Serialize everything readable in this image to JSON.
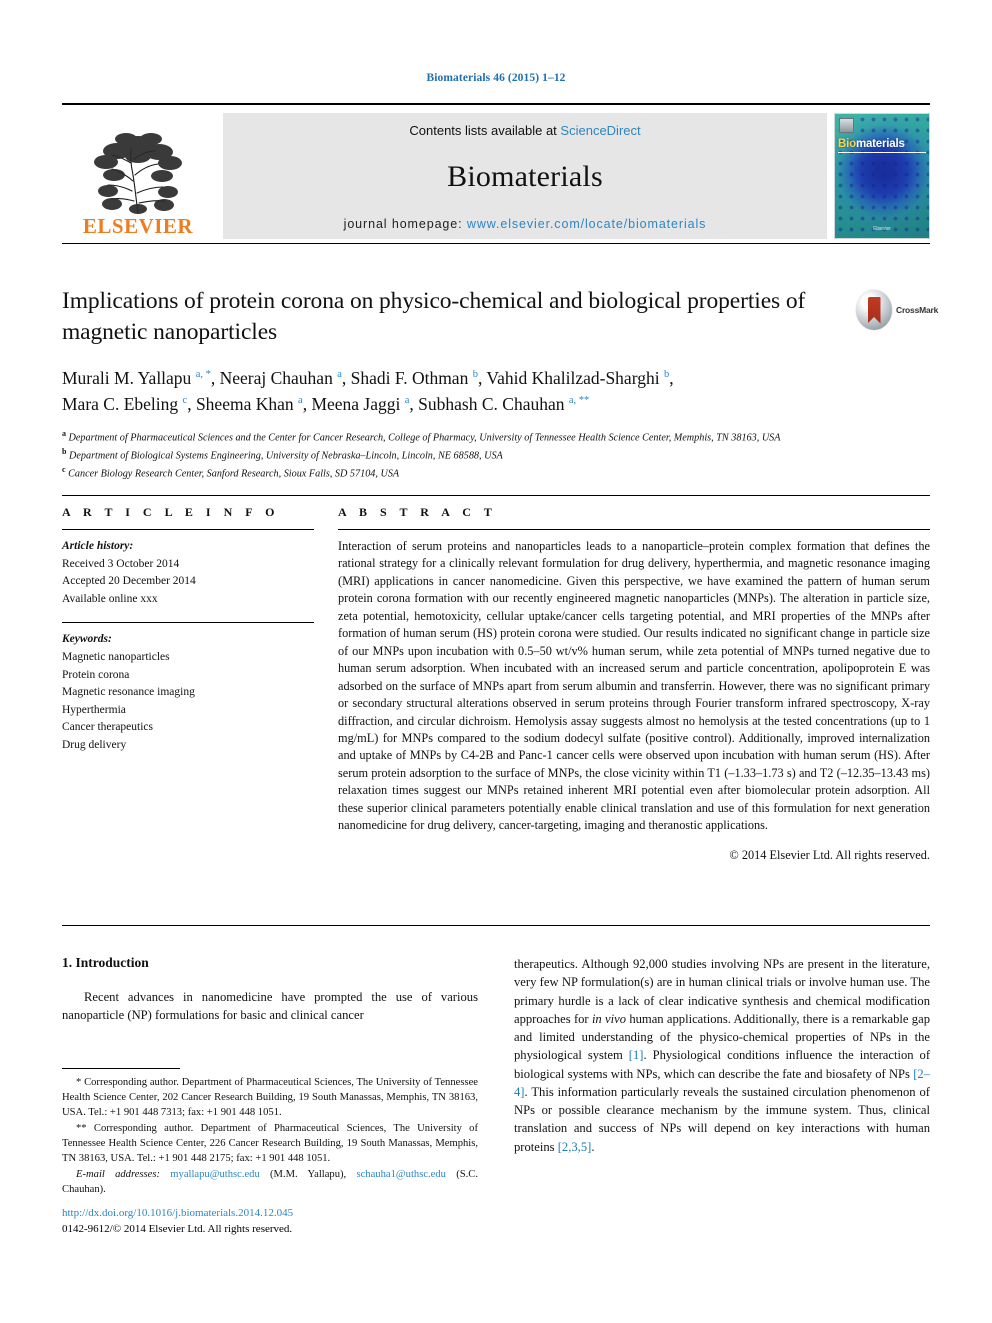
{
  "running_head": "Biomaterials 46 (2015) 1–12",
  "masthead": {
    "publisher_name": "ELSEVIER",
    "contents_prefix": "Contents lists available at",
    "contents_link": "ScienceDirect",
    "journal_name": "Biomaterials",
    "homepage_prefix": "journal homepage:",
    "homepage_url": "www.elsevier.com/locate/biomaterials",
    "cover_title_accent": "Bio",
    "cover_title_rest": "materials",
    "cover_footer": "Elsevier"
  },
  "article": {
    "title": "Implications of protein corona on physico-chemical and biological properties of magnetic nanoparticles",
    "crossmark_label": "CrossMark",
    "authors_line_1": "Murali M. Yallapu",
    "authors_html": "Murali M. Yallapu <sup>a, *</sup>, Neeraj Chauhan <sup>a</sup>, Shadi F. Othman <sup>b</sup>, Vahid Khalilzad-Sharghi <sup>b</sup>, Mara C. Ebeling <sup>c</sup>, Sheema Khan <sup>a</sup>, Meena Jaggi <sup>a</sup>, Subhash C. Chauhan <sup>a, **</sup>",
    "affiliation_a": "Department of Pharmaceutical Sciences and the Center for Cancer Research, College of Pharmacy, University of Tennessee Health Science Center, Memphis, TN 38163, USA",
    "affiliation_b": "Department of Biological Systems Engineering, University of Nebraska–Lincoln, Lincoln, NE 68588, USA",
    "affiliation_c": "Cancer Biology Research Center, Sanford Research, Sioux Falls, SD 57104, USA"
  },
  "article_info": {
    "heading": "A R T I C L E  I N F O",
    "history_label": "Article history:",
    "received": "Received 3 October 2014",
    "accepted": "Accepted 20 December 2014",
    "available": "Available online xxx",
    "keywords_label": "Keywords:",
    "keywords": [
      "Magnetic nanoparticles",
      "Protein corona",
      "Magnetic resonance imaging",
      "Hyperthermia",
      "Cancer therapeutics",
      "Drug delivery"
    ]
  },
  "abstract": {
    "heading": "A B S T R A C T",
    "text": "Interaction of serum proteins and nanoparticles leads to a nanoparticle–protein complex formation that defines the rational strategy for a clinically relevant formulation for drug delivery, hyperthermia, and magnetic resonance imaging (MRI) applications in cancer nanomedicine. Given this perspective, we have examined the pattern of human serum protein corona formation with our recently engineered magnetic nanoparticles (MNPs). The alteration in particle size, zeta potential, hemotoxicity, cellular uptake/cancer cells targeting potential, and MRI properties of the MNPs after formation of human serum (HS) protein corona were studied. Our results indicated no significant change in particle size of our MNPs upon incubation with 0.5–50 wt/v% human serum, while zeta potential of MNPs turned negative due to human serum adsorption. When incubated with an increased serum and particle concentration, apolipoprotein E was adsorbed on the surface of MNPs apart from serum albumin and transferrin. However, there was no significant primary or secondary structural alterations observed in serum proteins through Fourier transform infrared spectroscopy, X-ray diffraction, and circular dichroism. Hemolysis assay suggests almost no hemolysis at the tested concentrations (up to 1 mg/mL) for MNPs compared to the sodium dodecyl sulfate (positive control). Additionally, improved internalization and uptake of MNPs by C4-2B and Panc-1 cancer cells were observed upon incubation with human serum (HS). After serum protein adsorption to the surface of MNPs, the close vicinity within T1 (–1.33–1.73 s) and T2 (–12.35–13.43 ms) relaxation times suggest our MNPs retained inherent MRI potential even after biomolecular protein adsorption. All these superior clinical parameters potentially enable clinical translation and use of this formulation for next generation nanomedicine for drug delivery, cancer-targeting, imaging and theranostic applications.",
    "copyright": "© 2014 Elsevier Ltd. All rights reserved."
  },
  "introduction": {
    "heading": "1.  Introduction",
    "para_left": "Recent advances in nanomedicine have prompted the use of various nanoparticle (NP) formulations for basic and clinical cancer",
    "para_right": "therapeutics. Although 92,000 studies involving NPs are present in the literature, very few NP formulation(s) are in human clinical trials or involve human use. The primary hurdle is a lack of clear indicative synthesis and chemical modification approaches for in vivo human applications. Additionally, there is a remarkable gap and limited understanding of the physico-chemical properties of NPs in the physiological system [1]. Physiological conditions influence the interaction of biological systems with NPs, which can describe the fate and biosafety of NPs [2–4]. This information particularly reveals the sustained circulation phenomenon of NPs or possible clearance mechanism by the immune system. Thus, clinical translation and success of NPs will depend on key interactions with human proteins [2,3,5]."
  },
  "footnotes": {
    "first": "* Corresponding author. Department of Pharmaceutical Sciences, The University of Tennessee Health Science Center, 202 Cancer Research Building, 19 South Manassas, Memphis, TN 38163, USA. Tel.: +1 901 448 7313; fax: +1 901 448 1051.",
    "second": "** Corresponding author. Department of Pharmaceutical Sciences, The University of Tennessee Health Science Center, 226 Cancer Research Building, 19 South Manassas, Memphis, TN 38163, USA. Tel.: +1 901 448 2175; fax: +1 901 448 1051.",
    "email_label": "E-mail addresses:",
    "email_1": "myallapu@uthsc.edu",
    "email_1_owner": "(M.M. Yallapu),",
    "email_2": "schauha1@uthsc.edu",
    "email_2_owner": "(S.C. Chauhan)."
  },
  "footer": {
    "doi": "http://dx.doi.org/10.1016/j.biomaterials.2014.12.045",
    "issn_line": "0142-9612/© 2014 Elsevier Ltd. All rights reserved."
  },
  "colors": {
    "link": "#2d86c4",
    "running_head": "#1f6fae",
    "elsevier_orange": "#ef7c20",
    "reference_blue": "#1f7ab8"
  }
}
